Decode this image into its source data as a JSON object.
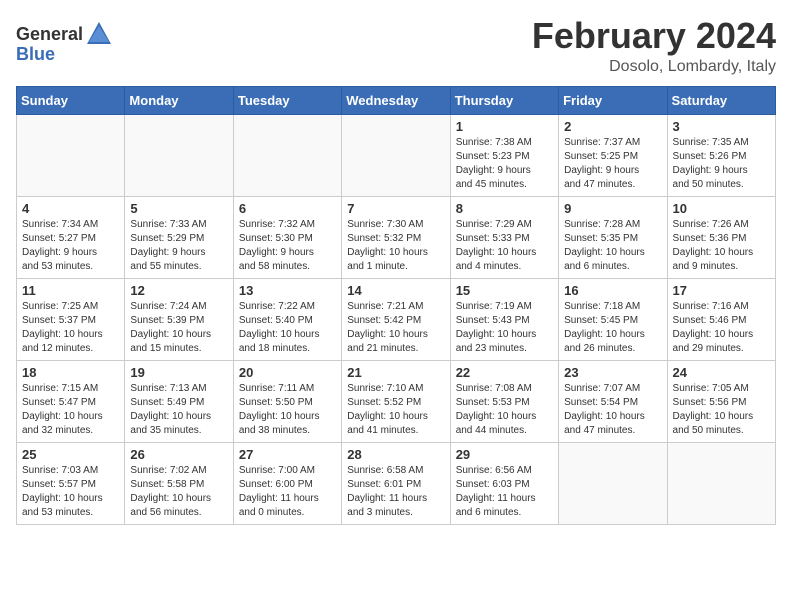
{
  "logo": {
    "text_general": "General",
    "text_blue": "Blue"
  },
  "header": {
    "month": "February 2024",
    "location": "Dosolo, Lombardy, Italy"
  },
  "days_of_week": [
    "Sunday",
    "Monday",
    "Tuesday",
    "Wednesday",
    "Thursday",
    "Friday",
    "Saturday"
  ],
  "weeks": [
    [
      {
        "day": "",
        "info": ""
      },
      {
        "day": "",
        "info": ""
      },
      {
        "day": "",
        "info": ""
      },
      {
        "day": "",
        "info": ""
      },
      {
        "day": "1",
        "info": "Sunrise: 7:38 AM\nSunset: 5:23 PM\nDaylight: 9 hours\nand 45 minutes."
      },
      {
        "day": "2",
        "info": "Sunrise: 7:37 AM\nSunset: 5:25 PM\nDaylight: 9 hours\nand 47 minutes."
      },
      {
        "day": "3",
        "info": "Sunrise: 7:35 AM\nSunset: 5:26 PM\nDaylight: 9 hours\nand 50 minutes."
      }
    ],
    [
      {
        "day": "4",
        "info": "Sunrise: 7:34 AM\nSunset: 5:27 PM\nDaylight: 9 hours\nand 53 minutes."
      },
      {
        "day": "5",
        "info": "Sunrise: 7:33 AM\nSunset: 5:29 PM\nDaylight: 9 hours\nand 55 minutes."
      },
      {
        "day": "6",
        "info": "Sunrise: 7:32 AM\nSunset: 5:30 PM\nDaylight: 9 hours\nand 58 minutes."
      },
      {
        "day": "7",
        "info": "Sunrise: 7:30 AM\nSunset: 5:32 PM\nDaylight: 10 hours\nand 1 minute."
      },
      {
        "day": "8",
        "info": "Sunrise: 7:29 AM\nSunset: 5:33 PM\nDaylight: 10 hours\nand 4 minutes."
      },
      {
        "day": "9",
        "info": "Sunrise: 7:28 AM\nSunset: 5:35 PM\nDaylight: 10 hours\nand 6 minutes."
      },
      {
        "day": "10",
        "info": "Sunrise: 7:26 AM\nSunset: 5:36 PM\nDaylight: 10 hours\nand 9 minutes."
      }
    ],
    [
      {
        "day": "11",
        "info": "Sunrise: 7:25 AM\nSunset: 5:37 PM\nDaylight: 10 hours\nand 12 minutes."
      },
      {
        "day": "12",
        "info": "Sunrise: 7:24 AM\nSunset: 5:39 PM\nDaylight: 10 hours\nand 15 minutes."
      },
      {
        "day": "13",
        "info": "Sunrise: 7:22 AM\nSunset: 5:40 PM\nDaylight: 10 hours\nand 18 minutes."
      },
      {
        "day": "14",
        "info": "Sunrise: 7:21 AM\nSunset: 5:42 PM\nDaylight: 10 hours\nand 21 minutes."
      },
      {
        "day": "15",
        "info": "Sunrise: 7:19 AM\nSunset: 5:43 PM\nDaylight: 10 hours\nand 23 minutes."
      },
      {
        "day": "16",
        "info": "Sunrise: 7:18 AM\nSunset: 5:45 PM\nDaylight: 10 hours\nand 26 minutes."
      },
      {
        "day": "17",
        "info": "Sunrise: 7:16 AM\nSunset: 5:46 PM\nDaylight: 10 hours\nand 29 minutes."
      }
    ],
    [
      {
        "day": "18",
        "info": "Sunrise: 7:15 AM\nSunset: 5:47 PM\nDaylight: 10 hours\nand 32 minutes."
      },
      {
        "day": "19",
        "info": "Sunrise: 7:13 AM\nSunset: 5:49 PM\nDaylight: 10 hours\nand 35 minutes."
      },
      {
        "day": "20",
        "info": "Sunrise: 7:11 AM\nSunset: 5:50 PM\nDaylight: 10 hours\nand 38 minutes."
      },
      {
        "day": "21",
        "info": "Sunrise: 7:10 AM\nSunset: 5:52 PM\nDaylight: 10 hours\nand 41 minutes."
      },
      {
        "day": "22",
        "info": "Sunrise: 7:08 AM\nSunset: 5:53 PM\nDaylight: 10 hours\nand 44 minutes."
      },
      {
        "day": "23",
        "info": "Sunrise: 7:07 AM\nSunset: 5:54 PM\nDaylight: 10 hours\nand 47 minutes."
      },
      {
        "day": "24",
        "info": "Sunrise: 7:05 AM\nSunset: 5:56 PM\nDaylight: 10 hours\nand 50 minutes."
      }
    ],
    [
      {
        "day": "25",
        "info": "Sunrise: 7:03 AM\nSunset: 5:57 PM\nDaylight: 10 hours\nand 53 minutes."
      },
      {
        "day": "26",
        "info": "Sunrise: 7:02 AM\nSunset: 5:58 PM\nDaylight: 10 hours\nand 56 minutes."
      },
      {
        "day": "27",
        "info": "Sunrise: 7:00 AM\nSunset: 6:00 PM\nDaylight: 11 hours\nand 0 minutes."
      },
      {
        "day": "28",
        "info": "Sunrise: 6:58 AM\nSunset: 6:01 PM\nDaylight: 11 hours\nand 3 minutes."
      },
      {
        "day": "29",
        "info": "Sunrise: 6:56 AM\nSunset: 6:03 PM\nDaylight: 11 hours\nand 6 minutes."
      },
      {
        "day": "",
        "info": ""
      },
      {
        "day": "",
        "info": ""
      }
    ]
  ]
}
